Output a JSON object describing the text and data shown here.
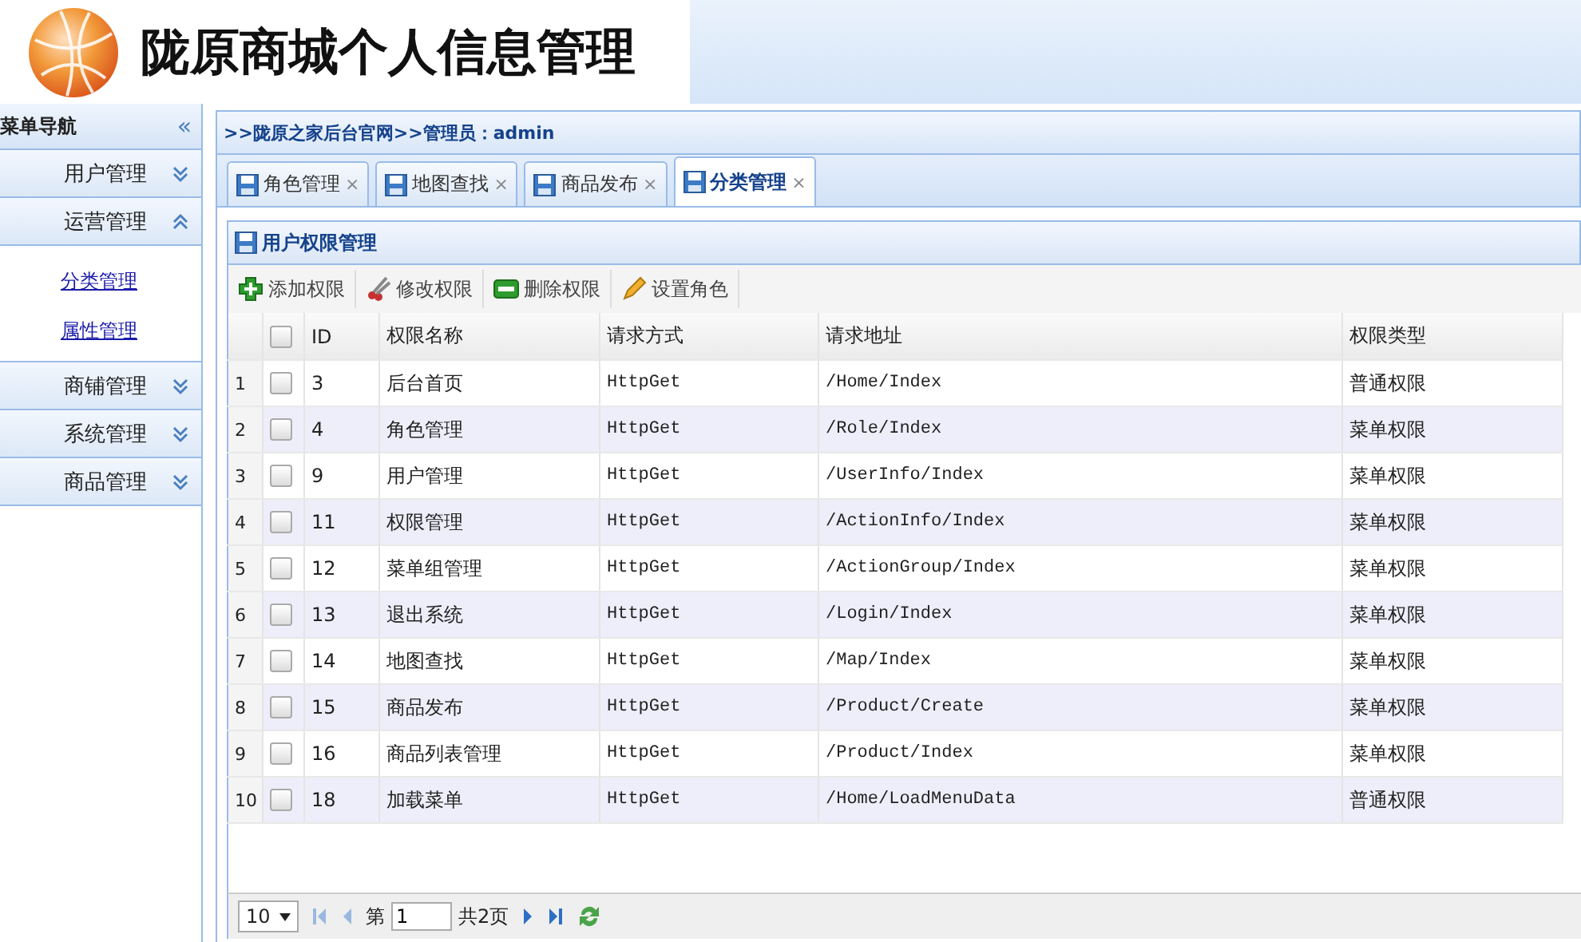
{
  "header": {
    "title": "陇原商城个人信息管理"
  },
  "sidebar": {
    "title": "菜单导航",
    "collapse_glyph": "«",
    "groups": [
      {
        "label": "用户管理",
        "expanded": false
      },
      {
        "label": "运营管理",
        "expanded": true,
        "children": [
          {
            "label": "分类管理"
          },
          {
            "label": "属性管理"
          }
        ]
      },
      {
        "label": "商铺管理",
        "expanded": false
      },
      {
        "label": "系统管理",
        "expanded": false
      },
      {
        "label": "商品管理",
        "expanded": false
      }
    ]
  },
  "breadcrumb": ">>陇原之家后台官网>>管理员：admin",
  "tabs": [
    {
      "label": "角色管理",
      "close": "×",
      "selected": false
    },
    {
      "label": "地图查找",
      "close": "×",
      "selected": false
    },
    {
      "label": "商品发布",
      "close": "×",
      "selected": false
    },
    {
      "label": "分类管理",
      "close": "×",
      "selected": true
    }
  ],
  "panel": {
    "title": "用户权限管理"
  },
  "toolbar": [
    {
      "kind": "add",
      "label": "添加权限"
    },
    {
      "kind": "edit",
      "label": "修改权限"
    },
    {
      "kind": "delete",
      "label": "删除权限"
    },
    {
      "kind": "role",
      "label": "设置角色"
    }
  ],
  "table": {
    "select_all_checked": false,
    "columns": [
      "ID",
      "权限名称",
      "请求方式",
      "请求地址",
      "权限类型"
    ],
    "rows": [
      {
        "number": "1",
        "checked": false,
        "cells": [
          "3",
          "后台首页",
          "HttpGet",
          "/Home/Index",
          "普通权限"
        ]
      },
      {
        "number": "2",
        "checked": false,
        "cells": [
          "4",
          "角色管理",
          "HttpGet",
          "/Role/Index",
          "菜单权限"
        ]
      },
      {
        "number": "3",
        "checked": false,
        "cells": [
          "9",
          "用户管理",
          "HttpGet",
          "/UserInfo/Index",
          "菜单权限"
        ]
      },
      {
        "number": "4",
        "checked": false,
        "cells": [
          "11",
          "权限管理",
          "HttpGet",
          "/ActionInfo/Index",
          "菜单权限"
        ]
      },
      {
        "number": "5",
        "checked": false,
        "cells": [
          "12",
          "菜单组管理",
          "HttpGet",
          "/ActionGroup/Index",
          "菜单权限"
        ]
      },
      {
        "number": "6",
        "checked": false,
        "cells": [
          "13",
          "退出系统",
          "HttpGet",
          "/Login/Index",
          "菜单权限"
        ]
      },
      {
        "number": "7",
        "checked": false,
        "cells": [
          "14",
          "地图查找",
          "HttpGet",
          "/Map/Index",
          "菜单权限"
        ]
      },
      {
        "number": "8",
        "checked": false,
        "cells": [
          "15",
          "商品发布",
          "HttpGet",
          "/Product/Create",
          "菜单权限"
        ]
      },
      {
        "number": "9",
        "checked": false,
        "cells": [
          "16",
          "商品列表管理",
          "HttpGet",
          "/Product/Index",
          "菜单权限"
        ]
      },
      {
        "number": "10",
        "checked": false,
        "cells": [
          "18",
          "加载菜单",
          "HttpGet",
          "/Home/LoadMenuData",
          "普通权限"
        ]
      }
    ]
  },
  "pager": {
    "page_size": "10",
    "page_prefix": "第",
    "page": "1",
    "total": "共2页"
  }
}
